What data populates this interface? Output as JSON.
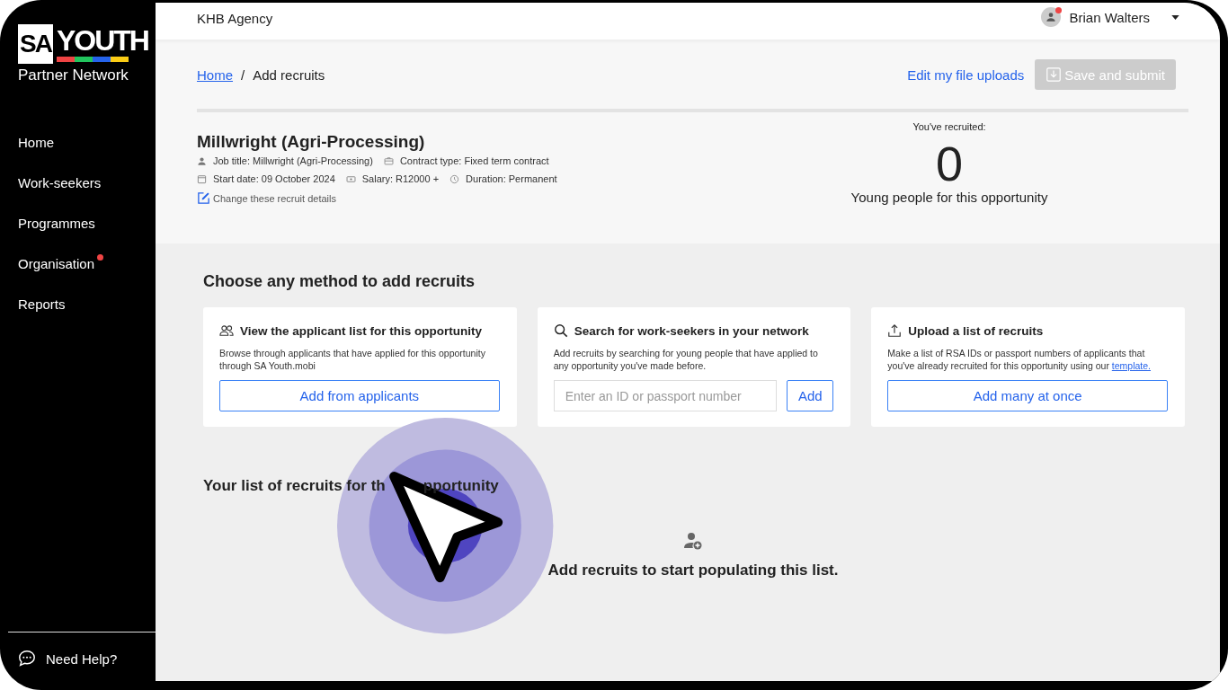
{
  "brand": {
    "box_text": "SA",
    "word": "YOUTH",
    "subtitle": "Partner Network"
  },
  "sidebar": {
    "items": [
      {
        "label": "Home",
        "dot": false
      },
      {
        "label": "Work-seekers",
        "dot": false
      },
      {
        "label": "Programmes",
        "dot": false
      },
      {
        "label": "Organisation",
        "dot": true
      },
      {
        "label": "Reports",
        "dot": false
      }
    ],
    "help": "Need Help?"
  },
  "topbar": {
    "agency": "KHB Agency",
    "user": "Brian Walters",
    "notification": true
  },
  "breadcrumb": {
    "items": [
      {
        "label": "Home",
        "kind": "link"
      },
      {
        "label": "Add recruits",
        "kind": "current"
      }
    ],
    "separator": "/"
  },
  "actions": {
    "link": "Edit my file uploads",
    "button": {
      "label": "Save and submit",
      "disabled": true
    }
  },
  "job": {
    "title": "Millwright (Agri-Processing)",
    "lines": [
      [
        {
          "kind": "person",
          "text": "Job title: Millwright (Agri-Processing)"
        },
        {
          "kind": "briefcase",
          "text": "Contract type: Fixed term contract"
        }
      ],
      [
        {
          "kind": "calendar",
          "text": "Start date: 09 October 2024"
        },
        {
          "kind": "money",
          "text": "Salary: R12000 +"
        },
        {
          "kind": "clock",
          "text": "Duration: Permanent"
        }
      ]
    ],
    "edit_link": "Change these recruit details"
  },
  "summary": {
    "label": "You've recruited:",
    "count": "0",
    "caption": "Young people for this opportunity"
  },
  "methods": {
    "heading": "Choose any method to add recruits",
    "cards": [
      {
        "kind": "applicants",
        "title": "View the applicant list for this opportunity",
        "description": "Browse through applicants that have applied for this opportunity through SA Youth.mobi",
        "button": "Add from applicants"
      },
      {
        "kind": "search",
        "title": "Search for work-seekers in your network",
        "description": "Add recruits by searching for young people that have applied to any opportunity you've made before.",
        "placeholder": "Enter an ID or passport number",
        "button": "Add"
      },
      {
        "kind": "upload",
        "title": "Upload a list of recruits",
        "description": "Make a list of RSA IDs or passport numbers of applicants that you've already recruited for this opportunity using our",
        "link": "template.",
        "button": "Add many at once"
      }
    ]
  },
  "recruits": {
    "heading_parts": [
      "Your list of recruits for th",
      "pportunity"
    ],
    "empty": "Add recruits to start populating this list."
  }
}
